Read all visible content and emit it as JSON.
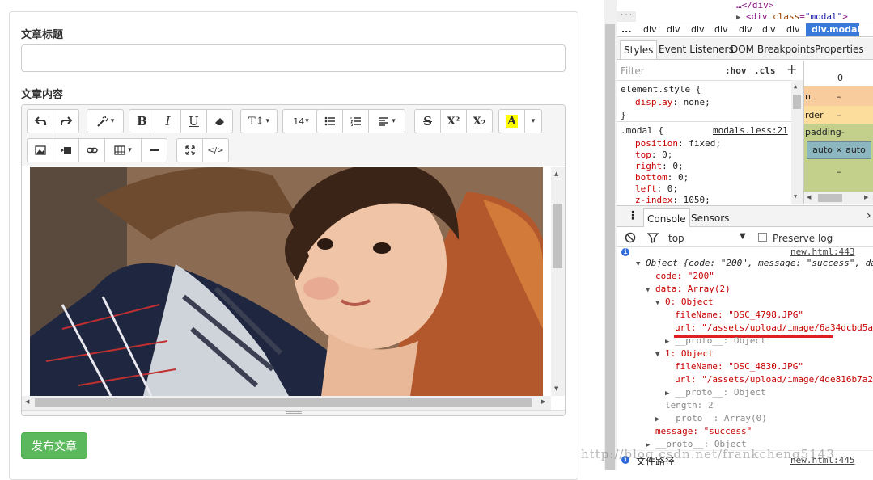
{
  "form": {
    "title_label": "文章标题",
    "title_value": "",
    "content_label": "文章内容",
    "publish_label": "发布文章"
  },
  "toolbar": {
    "font_size": "14",
    "font_size_caret": "▾",
    "caret": "▾",
    "text_style": "T↕",
    "bold": "B",
    "italic": "I",
    "underline": "U",
    "strike": "S",
    "superscript": "X²",
    "subscript": "X₂",
    "color": "A",
    "code": "</>"
  },
  "devtools": {
    "elements": {
      "line1": "…</div>",
      "line2_tag_open": "<div ",
      "line2_attr": "class",
      "line2_eq": "=",
      "line2_val": "\"modal\"",
      "line2_close": ">"
    },
    "breadcrumb": [
      "...",
      "div",
      "div",
      "div",
      "div",
      "div",
      "div",
      "div",
      "div.modal"
    ],
    "style_tabs": [
      "Styles",
      "Event Listeners",
      "DOM Breakpoints",
      "Properties"
    ],
    "filter_placeholder": "Filter",
    "hov": ":hov",
    "cls": ".cls",
    "plus": "+",
    "element_style": "element.style {",
    "display_prop": "display",
    "display_val": "none;",
    "close_brace": "}",
    "modal_selector": ".modal {",
    "modal_link": "modals.less:21",
    "modal_rules": [
      {
        "prop": "position",
        "val": "fixed;"
      },
      {
        "prop": "top",
        "val": "0;"
      },
      {
        "prop": "right",
        "val": "0;"
      },
      {
        "prop": "bottom",
        "val": "0;"
      },
      {
        "prop": "left",
        "val": "0;"
      },
      {
        "prop": "z-index",
        "val": "1050;"
      }
    ],
    "box_model": {
      "zero": "0",
      "margin": "n",
      "border": "rder",
      "padding": "padding-",
      "dash": "–",
      "content": "auto × auto"
    },
    "drawer_tabs": [
      "Console",
      "Sensors"
    ],
    "context": "top",
    "preserve_log": "Preserve log",
    "log_link1": "new.html:443",
    "log_link2": "new.html:445",
    "object_summary": "Object {code: \"200\", message: \"success\", da",
    "code_line": "code: \"200\"",
    "data_line": "data: Array(2)",
    "item0": "0: Object",
    "fileName0": "fileName: \"DSC_4798.JPG\"",
    "url0": "url: \"/assets/upload/image/6a34dcbd5a",
    "proto0": "__proto__: Object",
    "item1": "1: Object",
    "fileName1": "fileName: \"DSC_4830.JPG\"",
    "url1": "url: \"/assets/upload/image/4de816b7a2",
    "proto1": "__proto__: Object",
    "length_line": "length: 2",
    "proto_array": "__proto__: Array(0)",
    "message_line": "message: \"success\"",
    "proto_obj": "__proto__: Object",
    "last_text": "文件路径",
    "watermark": "http://blog.csdn.net/frankcheng5143"
  },
  "colors": {
    "publish": "#5cb85c",
    "highlight_yellow": "#ffff00",
    "annotation_red": "#e02020",
    "devtools_selected": "#3879d9"
  }
}
